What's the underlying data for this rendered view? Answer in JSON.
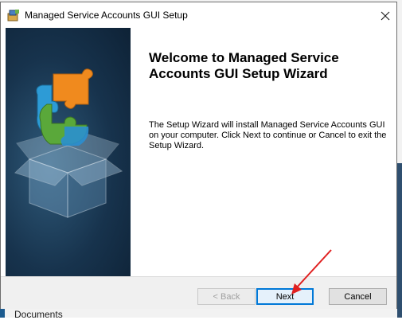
{
  "window": {
    "title": "Managed Service Accounts GUI Setup",
    "close_icon": "close-icon",
    "app_icon": "installer-icon"
  },
  "wizard": {
    "heading": "Welcome to Managed Service Accounts GUI Setup Wizard",
    "description": "The Setup Wizard will install Managed Service Accounts GUI on your computer.  Click Next to continue or Cancel to exit the Setup Wizard."
  },
  "buttons": {
    "back_label": "< Back",
    "next_label": "Next",
    "cancel_label": "Cancel"
  },
  "background": {
    "partial_text": "Documents"
  },
  "colors": {
    "focus_border": "#0078d7",
    "annotation_arrow": "#e02020",
    "art_background": "#17334d"
  }
}
